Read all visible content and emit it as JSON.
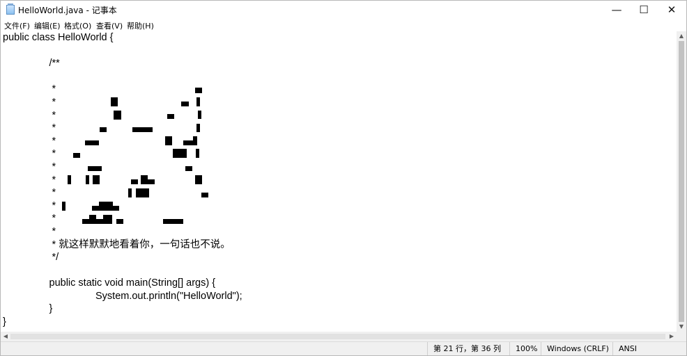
{
  "window": {
    "title": "HelloWorld.java - 记事本",
    "controls": {
      "minimize": "—",
      "maximize": "☐",
      "close": "✕"
    }
  },
  "menu": [
    "文件(F)",
    "编辑(E)",
    "格式(O)",
    "查看(V)",
    "帮助(H)"
  ],
  "editor": {
    "lines": [
      "public class HelloWorld {",
      "",
      "\t/**",
      "",
      "\t *",
      "\t *",
      "\t *",
      "\t *",
      "\t *",
      "\t *",
      "\t *",
      "\t *",
      "\t *",
      "\t *",
      "\t *",
      "\t *",
      "\t * 就这样默默地看着你，一句话也不说。",
      "\t */",
      "",
      "\tpublic static void main(String[] args) {",
      "\t\tSystem.out.println(\"HelloWorld\");",
      "\t}",
      "}"
    ]
  },
  "scrollbars": {
    "up": "▲",
    "down": "▼",
    "left": "◀",
    "right": "▶"
  },
  "status": {
    "position": "第 21 行，第 36 列",
    "zoom": "100%",
    "line_ending": "Windows (CRLF)",
    "encoding": "ANSI"
  }
}
